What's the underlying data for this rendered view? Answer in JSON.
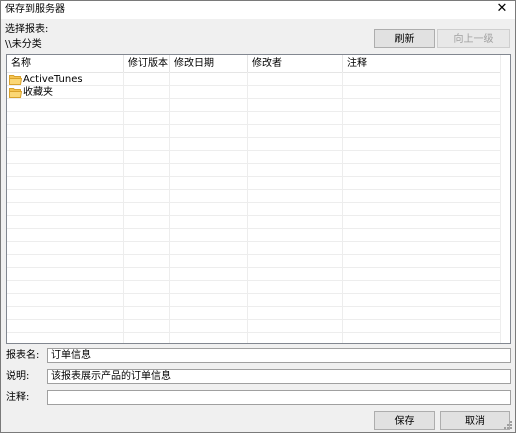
{
  "window": {
    "title": "保存到服务器",
    "close_glyph": "✕"
  },
  "report_select": {
    "label": "选择报表:",
    "current_path": "\\\\未分类"
  },
  "toolbar": {
    "refresh_label": "刷新",
    "up_label": "向上一级"
  },
  "list": {
    "columns": [
      "名称",
      "修订版本",
      "修改日期",
      "修改者",
      "注释"
    ],
    "items": [
      {
        "name": "ActiveTunes",
        "icon": "folder-icon"
      },
      {
        "name": "收藏夹",
        "icon": "folder-icon"
      }
    ]
  },
  "form": {
    "name_label": "报表名:",
    "name_value": "订单信息",
    "desc_label": "说明:",
    "desc_value": "该报表展示产品的订单信息",
    "comment_label": "注释:",
    "comment_value": ""
  },
  "footer": {
    "save_label": "保存",
    "cancel_label": "取消"
  },
  "colors": {
    "folder": "#f5c452",
    "folder_dark": "#d9a22b",
    "window_bg": "#f0f0f0",
    "border": "#828790"
  }
}
